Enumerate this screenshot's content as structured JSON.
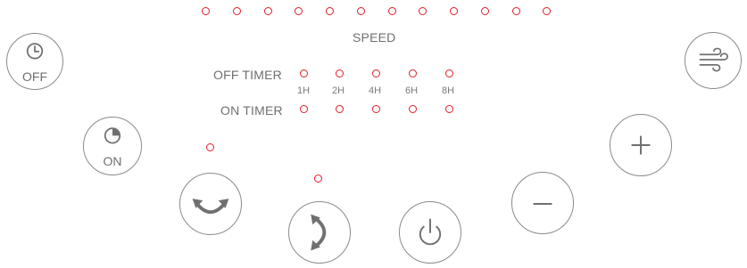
{
  "panel": {
    "speed_label": "SPEED",
    "speed_led_count": 12,
    "off_timer_label": "OFF TIMER",
    "on_timer_label": "ON TIMER",
    "timer_options": [
      "1H",
      "2H",
      "4H",
      "6H",
      "8H"
    ],
    "off_button_label": "OFF",
    "on_button_label": "ON"
  },
  "colors": {
    "indicator": "#e01e24",
    "outline": "#8a8a8a",
    "text": "#6f6f6f"
  },
  "icons": {
    "off_timer": "clock-icon",
    "on_timer": "timer-pie-icon",
    "oscillate_horizontal": "rotate-horizontal-icon",
    "oscillate_vertical": "rotate-vertical-icon",
    "power": "power-icon",
    "minus": "minus-icon",
    "plus": "plus-icon",
    "wind": "wind-icon"
  }
}
